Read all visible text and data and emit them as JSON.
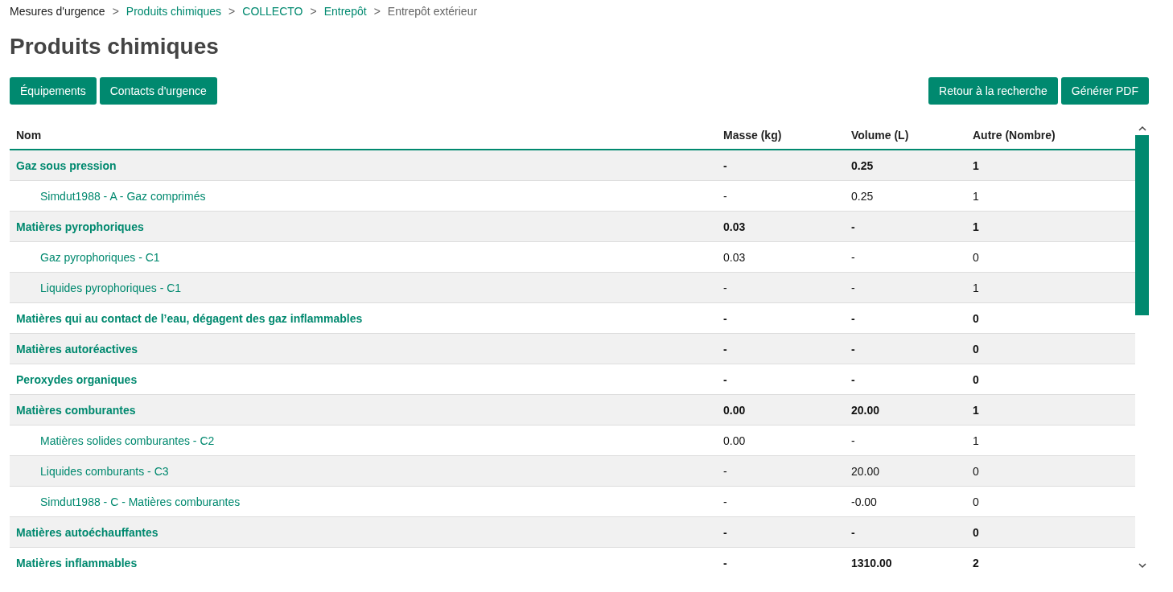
{
  "breadcrumb": {
    "separators": [
      ">",
      ">",
      ">",
      ">"
    ],
    "items": [
      {
        "label": "Mesures d'urgence",
        "kind": "plain"
      },
      {
        "label": "Produits chimiques",
        "kind": "link"
      },
      {
        "label": "COLLECTO",
        "kind": "link"
      },
      {
        "label": "Entrepôt",
        "kind": "link"
      },
      {
        "label": "Entrepôt extérieur",
        "kind": "current"
      }
    ]
  },
  "title": "Produits chimiques",
  "toolbar": {
    "left": [
      "Équipements",
      "Contacts d'urgence"
    ],
    "right": [
      "Retour à la recherche",
      "Générer PDF"
    ]
  },
  "table": {
    "columns": [
      "Nom",
      "Masse (kg)",
      "Volume (L)",
      "Autre (Nombre)"
    ],
    "rows": [
      {
        "kind": "group",
        "cells": [
          "Gaz sous pression",
          "-",
          "0.25",
          "1"
        ]
      },
      {
        "kind": "item",
        "cells": [
          "Simdut1988 - A - Gaz comprimés",
          "-",
          "0.25",
          "1"
        ]
      },
      {
        "kind": "group",
        "cells": [
          "Matières pyrophoriques",
          "0.03",
          "-",
          "1"
        ]
      },
      {
        "kind": "item",
        "cells": [
          "Gaz pyrophoriques - C1",
          "0.03",
          "-",
          "0"
        ]
      },
      {
        "kind": "item",
        "cells": [
          "Liquides pyrophoriques - C1",
          "-",
          "-",
          "1"
        ]
      },
      {
        "kind": "group",
        "cells": [
          "Matières qui au contact de l’eau, dégagent des gaz inflammables",
          "-",
          "-",
          "0"
        ]
      },
      {
        "kind": "group",
        "cells": [
          "Matières autoréactives",
          "-",
          "-",
          "0"
        ]
      },
      {
        "kind": "group",
        "cells": [
          "Peroxydes organiques",
          "-",
          "-",
          "0"
        ]
      },
      {
        "kind": "group",
        "cells": [
          "Matières comburantes",
          "0.00",
          "20.00",
          "1"
        ]
      },
      {
        "kind": "item",
        "cells": [
          "Matières solides comburantes - C2",
          "0.00",
          "-",
          "1"
        ]
      },
      {
        "kind": "item",
        "cells": [
          "Liquides comburants - C3",
          "-",
          "20.00",
          "0"
        ]
      },
      {
        "kind": "item",
        "cells": [
          "Simdut1988 - C - Matières comburantes",
          "-",
          "-0.00",
          "0"
        ]
      },
      {
        "kind": "group",
        "cells": [
          "Matières autoéchauffantes",
          "-",
          "-",
          "0"
        ]
      },
      {
        "kind": "group",
        "cells": [
          "Matières inflammables",
          "-",
          "1310.00",
          "2"
        ]
      }
    ]
  }
}
